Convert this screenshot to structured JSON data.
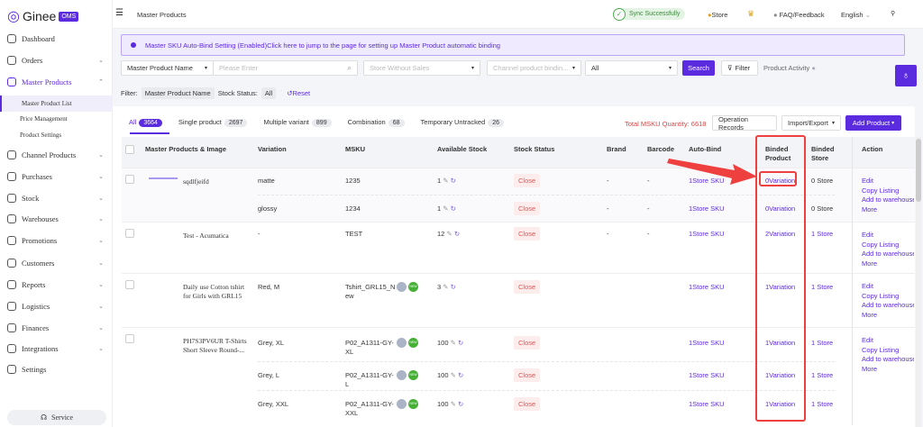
{
  "app": {
    "logo": "Ginee",
    "badge": "OMS"
  },
  "header": {
    "title": "Master Products",
    "sync": "Sync Successfully",
    "store": "Store",
    "faq": "FAQ/Feedback",
    "language": "English"
  },
  "sidebar": {
    "items": [
      {
        "label": "Dashboard",
        "chevron": ""
      },
      {
        "label": "Orders",
        "chevron": "⌄"
      },
      {
        "label": "Master Products",
        "chevron": "⌃"
      },
      {
        "label": "Channel Products",
        "chevron": "⌄"
      },
      {
        "label": "Purchases",
        "chevron": "⌄"
      },
      {
        "label": "Stock",
        "chevron": "⌄"
      },
      {
        "label": "Warehouses",
        "chevron": "⌄"
      },
      {
        "label": "Promotions",
        "chevron": "⌄"
      },
      {
        "label": "Customers",
        "chevron": "⌄"
      },
      {
        "label": "Reports",
        "chevron": "⌄"
      },
      {
        "label": "Logistics",
        "chevron": "⌄"
      },
      {
        "label": "Finances",
        "chevron": "⌄"
      },
      {
        "label": "Integrations",
        "chevron": "⌄"
      },
      {
        "label": "Settings",
        "chevron": ""
      }
    ],
    "subitems": [
      "Master Product List",
      "Price Management",
      "Product Settings"
    ],
    "service": "Service"
  },
  "banner": "Master SKU Auto-Bind Setting (Enabled)Click here to jump to the page for setting up Master Product automatic binding",
  "search": {
    "field": "Master Product Name",
    "placeholder": "Please Enter",
    "store_placeholder": "Store Without Sales",
    "binding_placeholder": "Channel product bindin...",
    "all": "All",
    "search": "Search",
    "filter": "Filter",
    "activity": "Product Activity"
  },
  "filters": {
    "label": "Filter:",
    "name_chip": "Master Product Name",
    "stock_label": "Stock Status:",
    "stock_value": "All",
    "reset": "Reset"
  },
  "tabs": [
    {
      "label": "All",
      "count": "3664"
    },
    {
      "label": "Single product",
      "count": "2697"
    },
    {
      "label": "Multiple variant",
      "count": "899"
    },
    {
      "label": "Combination",
      "count": "68"
    },
    {
      "label": "Temporary Untracked",
      "count": "26"
    }
  ],
  "toolbar": {
    "total_label": "Total MSKU Quantity:",
    "total": "6618",
    "records": "Operation Records",
    "import": "Import/Export",
    "add": "Add Product"
  },
  "columns": [
    "Master Products & Image",
    "Variation",
    "MSKU",
    "Available Stock",
    "Stock Status",
    "Brand",
    "Barcode",
    "Auto-Bind",
    "Binded Product",
    "Binded Store",
    "Action"
  ],
  "products": [
    {
      "name": "sqdlfjeifd",
      "image": "placeholder",
      "variants": [
        {
          "variation": "matte",
          "msku": "1235",
          "stock": "1",
          "status": "Close",
          "brand": "-",
          "barcode": "-",
          "autobind": "1Store SKU",
          "binded": "0Variation",
          "store": "0 Store"
        },
        {
          "variation": "glossy",
          "msku": "1234",
          "stock": "1",
          "status": "Close",
          "brand": "-",
          "barcode": "-",
          "autobind": "1Store SKU",
          "binded": "0Variation",
          "store": "0 Store"
        }
      ]
    },
    {
      "name": "Test - Acumatica",
      "image": "princesses",
      "variants": [
        {
          "variation": "-",
          "msku": "TEST",
          "stock": "12",
          "status": "Close",
          "brand": "-",
          "barcode": "-",
          "autobind": "1Store SKU",
          "binded": "2Variation",
          "store": "1 Store"
        }
      ]
    },
    {
      "name": "Daily use Cotton tshirt for Girls with GRL15",
      "image": "red-shirt",
      "variants": [
        {
          "variation": "Red, M",
          "msku": "Tshirt_GRL15_New",
          "stock": "3",
          "status": "Close",
          "brand": "",
          "barcode": "",
          "autobind": "1Store SKU",
          "binded": "1Variation",
          "store": "1 Store",
          "new": "NEW"
        }
      ]
    },
    {
      "name": "PH7S3PV6UR T-Shirts Short Sleeve Round-...",
      "image": "model",
      "variants": [
        {
          "variation": "Grey, XL",
          "msku": "P02_A1311-GY-XL",
          "stock": "100",
          "status": "Close",
          "autobind": "1Store SKU",
          "binded": "1Variation",
          "store": "1 Store",
          "new": "NEW"
        },
        {
          "variation": "Grey, L",
          "msku": "P02_A1311-GY-L",
          "stock": "100",
          "status": "Close",
          "autobind": "1Store SKU",
          "binded": "1Variation",
          "store": "1 Store",
          "new": "NEW"
        },
        {
          "variation": "Grey, XXL",
          "msku": "P02_A1311-GY-XXL",
          "stock": "100",
          "status": "Close",
          "autobind": "1Store SKU",
          "binded": "1Variation",
          "store": "1 Store",
          "new": "NEW"
        }
      ]
    }
  ],
  "actions": [
    "Edit",
    "Copy Listing",
    "Add to warehouse",
    "More"
  ],
  "colors": {
    "accent": "#5b2be0",
    "annotation": "#ef4040",
    "close": "#e25555"
  }
}
